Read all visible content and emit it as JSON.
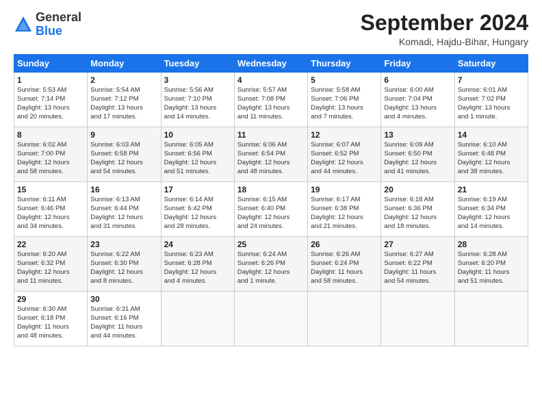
{
  "logo": {
    "general": "General",
    "blue": "Blue"
  },
  "header": {
    "month_year": "September 2024",
    "location": "Komadi, Hajdu-Bihar, Hungary"
  },
  "weekdays": [
    "Sunday",
    "Monday",
    "Tuesday",
    "Wednesday",
    "Thursday",
    "Friday",
    "Saturday"
  ],
  "weeks": [
    [
      {
        "day": "1",
        "info": "Sunrise: 5:53 AM\nSunset: 7:14 PM\nDaylight: 13 hours\nand 20 minutes."
      },
      {
        "day": "2",
        "info": "Sunrise: 5:54 AM\nSunset: 7:12 PM\nDaylight: 13 hours\nand 17 minutes."
      },
      {
        "day": "3",
        "info": "Sunrise: 5:56 AM\nSunset: 7:10 PM\nDaylight: 13 hours\nand 14 minutes."
      },
      {
        "day": "4",
        "info": "Sunrise: 5:57 AM\nSunset: 7:08 PM\nDaylight: 13 hours\nand 11 minutes."
      },
      {
        "day": "5",
        "info": "Sunrise: 5:58 AM\nSunset: 7:06 PM\nDaylight: 13 hours\nand 7 minutes."
      },
      {
        "day": "6",
        "info": "Sunrise: 6:00 AM\nSunset: 7:04 PM\nDaylight: 13 hours\nand 4 minutes."
      },
      {
        "day": "7",
        "info": "Sunrise: 6:01 AM\nSunset: 7:02 PM\nDaylight: 13 hours\nand 1 minute."
      }
    ],
    [
      {
        "day": "8",
        "info": "Sunrise: 6:02 AM\nSunset: 7:00 PM\nDaylight: 12 hours\nand 58 minutes."
      },
      {
        "day": "9",
        "info": "Sunrise: 6:03 AM\nSunset: 6:58 PM\nDaylight: 12 hours\nand 54 minutes."
      },
      {
        "day": "10",
        "info": "Sunrise: 6:05 AM\nSunset: 6:56 PM\nDaylight: 12 hours\nand 51 minutes."
      },
      {
        "day": "11",
        "info": "Sunrise: 6:06 AM\nSunset: 6:54 PM\nDaylight: 12 hours\nand 48 minutes."
      },
      {
        "day": "12",
        "info": "Sunrise: 6:07 AM\nSunset: 6:52 PM\nDaylight: 12 hours\nand 44 minutes."
      },
      {
        "day": "13",
        "info": "Sunrise: 6:09 AM\nSunset: 6:50 PM\nDaylight: 12 hours\nand 41 minutes."
      },
      {
        "day": "14",
        "info": "Sunrise: 6:10 AM\nSunset: 6:48 PM\nDaylight: 12 hours\nand 38 minutes."
      }
    ],
    [
      {
        "day": "15",
        "info": "Sunrise: 6:11 AM\nSunset: 6:46 PM\nDaylight: 12 hours\nand 34 minutes."
      },
      {
        "day": "16",
        "info": "Sunrise: 6:13 AM\nSunset: 6:44 PM\nDaylight: 12 hours\nand 31 minutes."
      },
      {
        "day": "17",
        "info": "Sunrise: 6:14 AM\nSunset: 6:42 PM\nDaylight: 12 hours\nand 28 minutes."
      },
      {
        "day": "18",
        "info": "Sunrise: 6:15 AM\nSunset: 6:40 PM\nDaylight: 12 hours\nand 24 minutes."
      },
      {
        "day": "19",
        "info": "Sunrise: 6:17 AM\nSunset: 6:38 PM\nDaylight: 12 hours\nand 21 minutes."
      },
      {
        "day": "20",
        "info": "Sunrise: 6:18 AM\nSunset: 6:36 PM\nDaylight: 12 hours\nand 18 minutes."
      },
      {
        "day": "21",
        "info": "Sunrise: 6:19 AM\nSunset: 6:34 PM\nDaylight: 12 hours\nand 14 minutes."
      }
    ],
    [
      {
        "day": "22",
        "info": "Sunrise: 6:20 AM\nSunset: 6:32 PM\nDaylight: 12 hours\nand 11 minutes."
      },
      {
        "day": "23",
        "info": "Sunrise: 6:22 AM\nSunset: 6:30 PM\nDaylight: 12 hours\nand 8 minutes."
      },
      {
        "day": "24",
        "info": "Sunrise: 6:23 AM\nSunset: 6:28 PM\nDaylight: 12 hours\nand 4 minutes."
      },
      {
        "day": "25",
        "info": "Sunrise: 6:24 AM\nSunset: 6:26 PM\nDaylight: 12 hours\nand 1 minute."
      },
      {
        "day": "26",
        "info": "Sunrise: 6:26 AM\nSunset: 6:24 PM\nDaylight: 11 hours\nand 58 minutes."
      },
      {
        "day": "27",
        "info": "Sunrise: 6:27 AM\nSunset: 6:22 PM\nDaylight: 11 hours\nand 54 minutes."
      },
      {
        "day": "28",
        "info": "Sunrise: 6:28 AM\nSunset: 6:20 PM\nDaylight: 11 hours\nand 51 minutes."
      }
    ],
    [
      {
        "day": "29",
        "info": "Sunrise: 6:30 AM\nSunset: 6:18 PM\nDaylight: 11 hours\nand 48 minutes."
      },
      {
        "day": "30",
        "info": "Sunrise: 6:31 AM\nSunset: 6:16 PM\nDaylight: 11 hours\nand 44 minutes."
      },
      {
        "day": "",
        "info": ""
      },
      {
        "day": "",
        "info": ""
      },
      {
        "day": "",
        "info": ""
      },
      {
        "day": "",
        "info": ""
      },
      {
        "day": "",
        "info": ""
      }
    ]
  ]
}
